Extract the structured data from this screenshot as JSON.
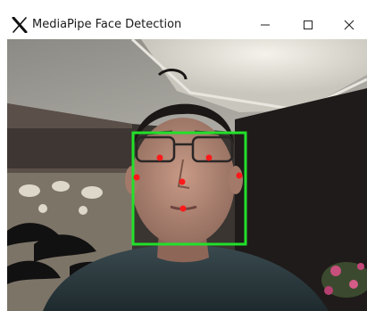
{
  "window": {
    "title": "MediaPipe Face Detection",
    "app_icon": "x-icon",
    "controls": {
      "minimize_icon": "minimize-icon",
      "maximize_icon": "maximize-icon",
      "close_icon": "close-icon"
    }
  },
  "detection": {
    "box_color": "#22e02a",
    "keypoint_color": "#ff1a1a",
    "keypoints": [
      "right-eye",
      "left-eye",
      "nose-tip",
      "mouth-center",
      "right-ear-tragion",
      "left-ear-tragion"
    ]
  }
}
